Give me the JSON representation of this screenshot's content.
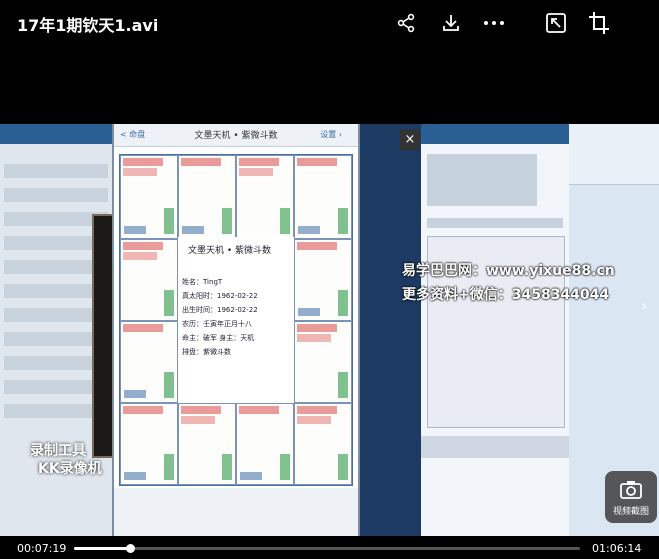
{
  "header": {
    "title": "17年1期钦天1.avi",
    "icons": [
      "share-icon",
      "download-icon",
      "more-icon",
      "pip-icon",
      "crop-icon"
    ]
  },
  "video": {
    "phone_title": "文墨天机 • 紫微斗数",
    "phone_left": "< 命盘",
    "phone_right": "设置 ›",
    "center_lines": [
      "文墨天机 • 紫微斗数",
      "姓名：TingT",
      "真太阳时：1962-02-22",
      "出生时间：1962-02-22",
      "农历：壬寅年正月十八",
      "命主：破军 身主：天机",
      "排盘：紫微斗数"
    ],
    "close": "×",
    "watermark_lines": [
      "易学巴巴网：www.yixue88.cn",
      "更多资料+微信：3458344044"
    ],
    "logo_lines": [
      "录制工具",
      "KK录像机"
    ],
    "side_arrow": "›"
  },
  "snapshot": {
    "label": "视频截图"
  },
  "playback": {
    "current": "00:07:19",
    "total": "01:06:14",
    "progress": 0.11
  }
}
